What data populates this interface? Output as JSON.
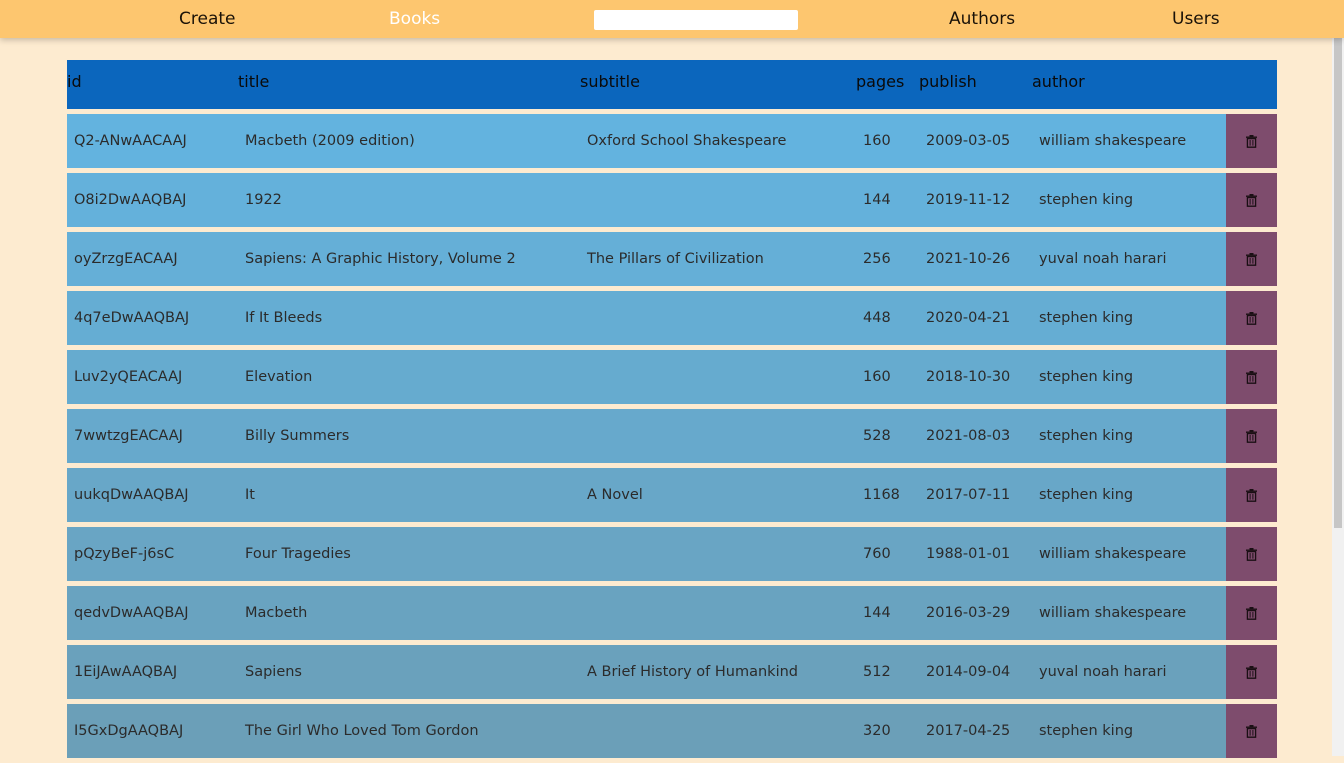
{
  "nav": {
    "create": "Create",
    "books": "Books",
    "search_value": "",
    "authors": "Authors",
    "users": "Users"
  },
  "table": {
    "headers": [
      "id",
      "title",
      "subtitle",
      "pages",
      "publish",
      "author"
    ],
    "rows": [
      {
        "id": "Q2-ANwAACAAJ",
        "title": "Macbeth (2009 edition)",
        "subtitle": "Oxford School Shakespeare",
        "pages": "160",
        "publish": "2009-03-05",
        "author": "william shakespeare"
      },
      {
        "id": "O8i2DwAAQBAJ",
        "title": "1922",
        "subtitle": "",
        "pages": "144",
        "publish": "2019-11-12",
        "author": "stephen king"
      },
      {
        "id": "oyZrzgEACAAJ",
        "title": "Sapiens: A Graphic History, Volume 2",
        "subtitle": "The Pillars of Civilization",
        "pages": "256",
        "publish": "2021-10-26",
        "author": "yuval noah harari"
      },
      {
        "id": "4q7eDwAAQBAJ",
        "title": "If It Bleeds",
        "subtitle": "",
        "pages": "448",
        "publish": "2020-04-21",
        "author": "stephen king"
      },
      {
        "id": "Luv2yQEACAAJ",
        "title": "Elevation",
        "subtitle": "",
        "pages": "160",
        "publish": "2018-10-30",
        "author": "stephen king"
      },
      {
        "id": "7wwtzgEACAAJ",
        "title": "Billy Summers",
        "subtitle": "",
        "pages": "528",
        "publish": "2021-08-03",
        "author": "stephen king"
      },
      {
        "id": "uukqDwAAQBAJ",
        "title": "It",
        "subtitle": "A Novel",
        "pages": "1168",
        "publish": "2017-07-11",
        "author": "stephen king"
      },
      {
        "id": "pQzyBeF-j6sC",
        "title": "Four Tragedies",
        "subtitle": "",
        "pages": "760",
        "publish": "1988-01-01",
        "author": "william shakespeare"
      },
      {
        "id": "qedvDwAAQBAJ",
        "title": "Macbeth",
        "subtitle": "",
        "pages": "144",
        "publish": "2016-03-29",
        "author": "william shakespeare"
      },
      {
        "id": "1EiJAwAAQBAJ",
        "title": "Sapiens",
        "subtitle": "A Brief History of Humankind",
        "pages": "512",
        "publish": "2014-09-04",
        "author": "yuval noah harari"
      },
      {
        "id": "I5GxDgAAQBAJ",
        "title": "The Girl Who Loved Tom Gordon",
        "subtitle": "",
        "pages": "320",
        "publish": "2017-04-25",
        "author": "stephen king"
      }
    ],
    "delete_icon": "trash-icon"
  },
  "colors": {
    "page_bg": "#fdebd0",
    "nav_bg": "#fdc66f",
    "header_bg": "#0b66bd",
    "row_top": "#63b3df",
    "row_bottom": "#6b9fb8",
    "delete_bg": "#7e4c6d"
  }
}
